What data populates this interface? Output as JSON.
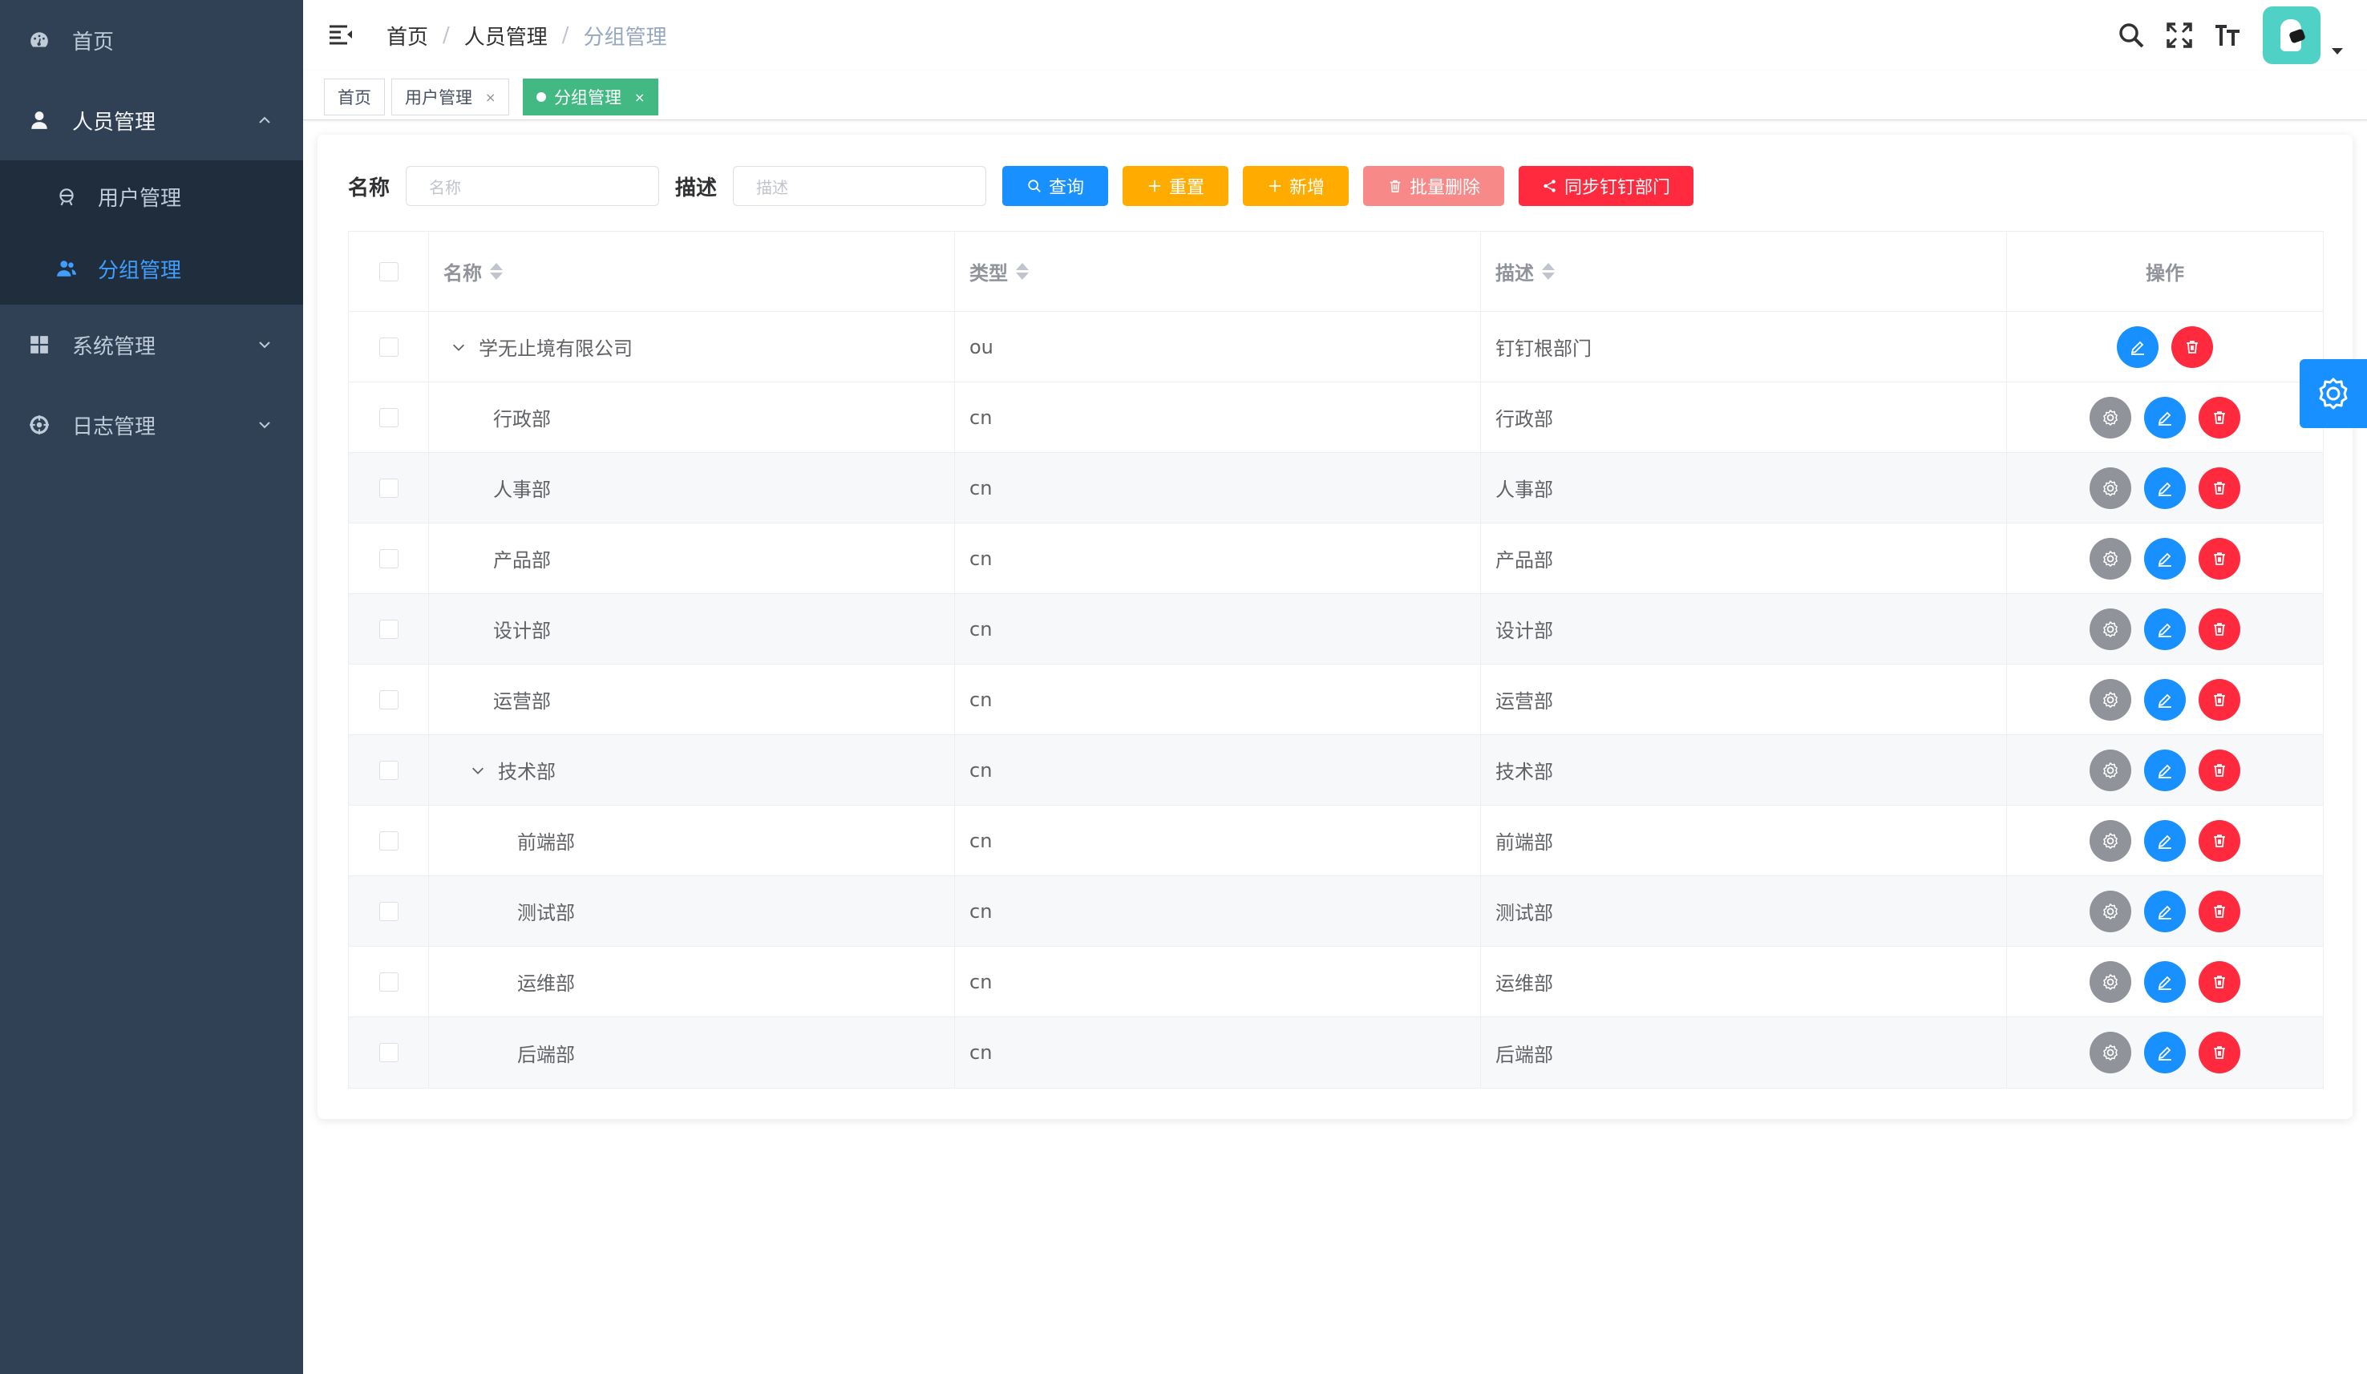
{
  "sidebar": {
    "items": [
      {
        "label": "首页",
        "icon": "dashboard-icon"
      },
      {
        "label": "人员管理",
        "icon": "user-icon"
      },
      {
        "label": "用户管理",
        "icon": "user-circle-icon"
      },
      {
        "label": "分组管理",
        "icon": "peoples-icon"
      },
      {
        "label": "系统管理",
        "icon": "grid-icon"
      },
      {
        "label": "日志管理",
        "icon": "log-icon"
      }
    ],
    "bg_color": "#304156",
    "active_color": "#409eff"
  },
  "navbar": {
    "breadcrumb": [
      "首页",
      "人员管理",
      "分组管理"
    ],
    "breadcrumb_sep": "/",
    "icons": [
      "search-icon",
      "fullscreen-icon",
      "font-size-icon",
      "avatar",
      "caret-down-icon"
    ]
  },
  "tags": [
    {
      "label": "首页",
      "closable": false
    },
    {
      "label": "用户管理",
      "closable": true
    },
    {
      "label": "分组管理",
      "closable": true,
      "active": true
    }
  ],
  "tag_close": "×",
  "search": {
    "name_label": "名称",
    "name_placeholder": "名称",
    "desc_label": "描述",
    "desc_placeholder": "描述",
    "buttons": {
      "query": "查询",
      "reset": "重置",
      "add": "新增",
      "batch_delete": "批量删除",
      "sync": "同步钉钉部门"
    }
  },
  "table": {
    "headers": {
      "name": "名称",
      "type": "类型",
      "desc": "描述",
      "ops": "操作"
    },
    "rows": [
      {
        "name": "学无止境有限公司",
        "type": "ou",
        "desc": "钉钉根部门",
        "level": 0,
        "expandable": true
      },
      {
        "name": "行政部",
        "type": "cn",
        "desc": "行政部",
        "level": 1,
        "expandable": false
      },
      {
        "name": "人事部",
        "type": "cn",
        "desc": "人事部",
        "level": 1,
        "expandable": false
      },
      {
        "name": "产品部",
        "type": "cn",
        "desc": "产品部",
        "level": 1,
        "expandable": false
      },
      {
        "name": "设计部",
        "type": "cn",
        "desc": "设计部",
        "level": 1,
        "expandable": false
      },
      {
        "name": "运营部",
        "type": "cn",
        "desc": "运营部",
        "level": 1,
        "expandable": false
      },
      {
        "name": "技术部",
        "type": "cn",
        "desc": "技术部",
        "level": 1,
        "expandable": true
      },
      {
        "name": "前端部",
        "type": "cn",
        "desc": "前端部",
        "level": 2,
        "expandable": false
      },
      {
        "name": "测试部",
        "type": "cn",
        "desc": "测试部",
        "level": 2,
        "expandable": false
      },
      {
        "name": "运维部",
        "type": "cn",
        "desc": "运维部",
        "level": 2,
        "expandable": false
      },
      {
        "name": "后端部",
        "type": "cn",
        "desc": "后端部",
        "level": 2,
        "expandable": false
      }
    ]
  },
  "colors": {
    "primary": "#1890ff",
    "warning": "#ffab00",
    "danger": "#ff2a3d",
    "danger_light": "#f78989",
    "tag_active": "#42b983",
    "info": "#909399"
  }
}
